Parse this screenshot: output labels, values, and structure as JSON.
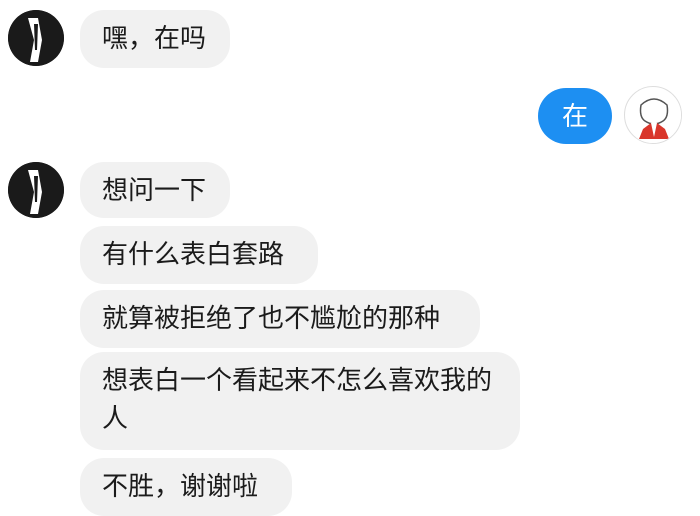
{
  "colors": {
    "incoming_bubble": "#f1f1f1",
    "outgoing_bubble": "#1d8ff2",
    "friend_avatar": "#1a1a1a"
  },
  "icons": {
    "friend_avatar": "avatar-icon",
    "my_avatar": "avatar-icon"
  },
  "messages": [
    {
      "sender": "friend",
      "text": "嘿，在吗"
    },
    {
      "sender": "me",
      "text": "在"
    },
    {
      "sender": "friend",
      "text": "想问一下"
    },
    {
      "sender": "friend",
      "text": "有什么表白套路"
    },
    {
      "sender": "friend",
      "text": "就算被拒绝了也不尴尬的那种"
    },
    {
      "sender": "friend",
      "text": "想表白一个看起来不怎么喜欢我的人"
    },
    {
      "sender": "friend",
      "text": "不胜，谢谢啦"
    }
  ]
}
